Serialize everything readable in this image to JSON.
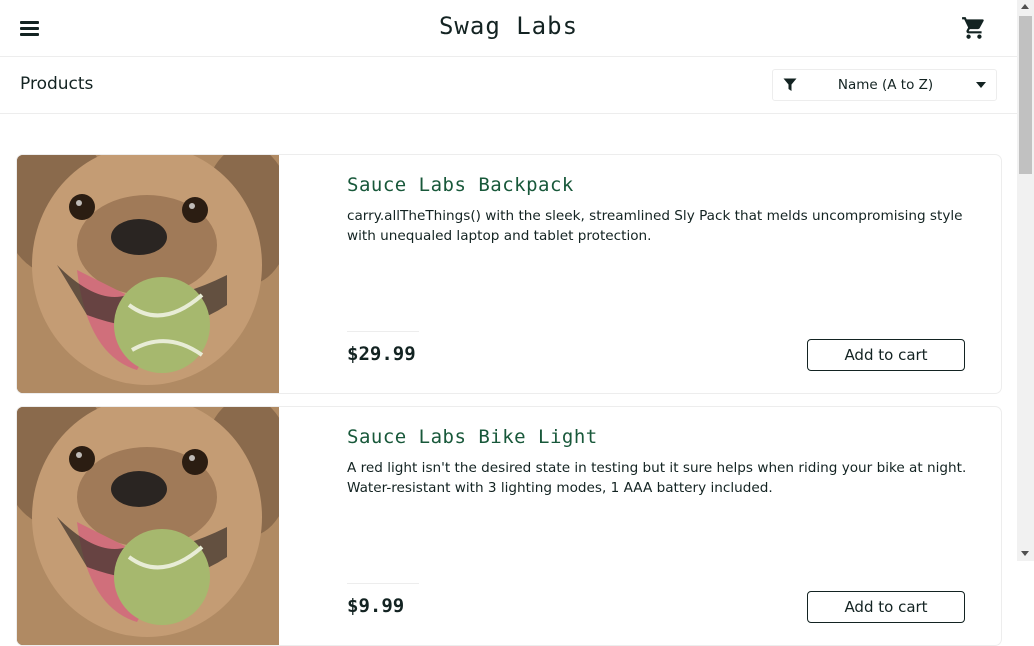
{
  "header": {
    "app_title": "Swag Labs",
    "menu_icon": "hamburger-menu-icon",
    "cart_icon": "shopping-cart-icon"
  },
  "toolbar": {
    "page_title": "Products",
    "sort": {
      "icon": "filter-icon",
      "selected": "Name (A to Z)"
    }
  },
  "products": [
    {
      "name": "Sauce Labs Backpack",
      "description": "carry.allTheThings() with the sleek, streamlined Sly Pack that melds uncompromising style with unequaled laptop and tablet protection.",
      "price": "$29.99",
      "button": "Add to cart",
      "image": "pug-with-tennis-ball-photo"
    },
    {
      "name": "Sauce Labs Bike Light",
      "description": "A red light isn't the desired state in testing but it sure helps when riding your bike at night. Water-resistant with 3 lighting modes, 1 AAA battery included.",
      "price": "$9.99",
      "button": "Add to cart",
      "image": "pug-with-tennis-ball-photo"
    }
  ],
  "colors": {
    "accent": "#18583a",
    "text": "#132322",
    "border": "#ededed"
  }
}
